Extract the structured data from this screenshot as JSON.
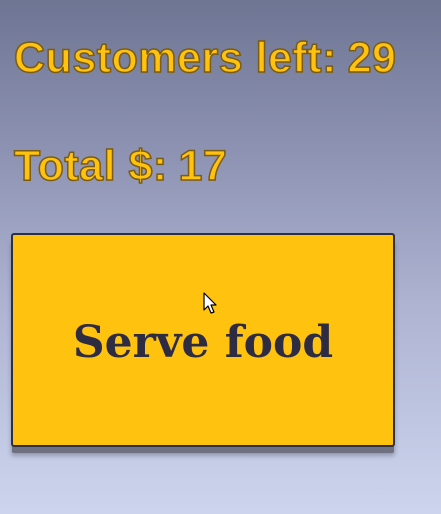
{
  "stats": {
    "customers_label": "Customers left:",
    "customers_value": "29",
    "total_label": "Total $:",
    "total_value": "17"
  },
  "serve_button": {
    "label": "Serve food"
  },
  "colors": {
    "accent": "#ffc20e",
    "text_dark": "#2e2c42",
    "background_top": "#6e7593",
    "background_bottom": "#cdd5ee"
  },
  "icons": {
    "cursor": "mouse-pointer-icon"
  }
}
